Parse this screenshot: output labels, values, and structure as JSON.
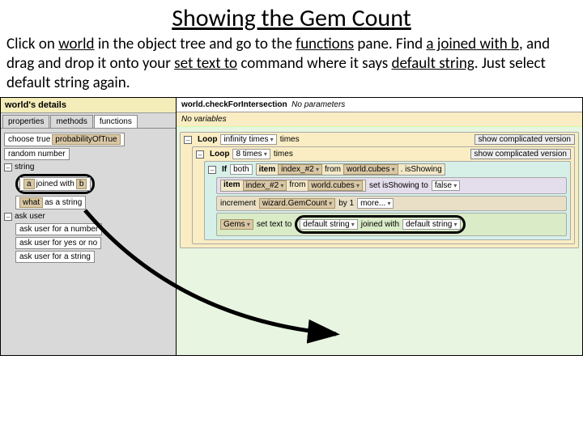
{
  "title": "Showing the Gem Count",
  "instr": {
    "pre": "Click on ",
    "world": "world",
    "t1": " in the object tree and go to the ",
    "functions": "functions",
    "t2": " pane. Find ",
    "ajb": "a joined with b",
    "t3": ", and drag and drop it onto your ",
    "settext": "set text to",
    "t4": " command where it says ",
    "ds": "default string",
    "t5": ". Just select default string again."
  },
  "left": {
    "heading": "world's details",
    "tabs": {
      "properties": "properties",
      "methods": "methods",
      "functions": "functions"
    },
    "rows": {
      "chooseTrue": "choose true",
      "prob": "probabilityOfTrue",
      "random": "random number",
      "catString": "string",
      "a": "a",
      "joined": "joined with",
      "b": "b",
      "what": "what",
      "asString": "as a string",
      "catAsk": "ask user",
      "askNum": "ask user for a number",
      "askYN": "ask user for yes or no",
      "askStr": "ask user for a string"
    }
  },
  "right": {
    "method": "world.checkForIntersection",
    "noParams": "No parameters",
    "noVars": "No variables",
    "loop": "Loop",
    "infinity": "infinity times",
    "times": "times",
    "showComp": "show complicated version",
    "eight": "8 times",
    "ifLbl": "If",
    "both": "both",
    "item": "item",
    "index": "index_#2",
    "from": "from",
    "cubes": "world.cubes",
    "isShowing": ". isShowing",
    "setIsShowing": "set isShowing to",
    "falseV": "false",
    "increment": "increment",
    "gemCount": "wizard.GemCount",
    "by1": "by 1",
    "more": "more...",
    "gems": "Gems",
    "setTextTo": "set text to",
    "defaultString": "default string",
    "joinedWith": "joined with"
  }
}
